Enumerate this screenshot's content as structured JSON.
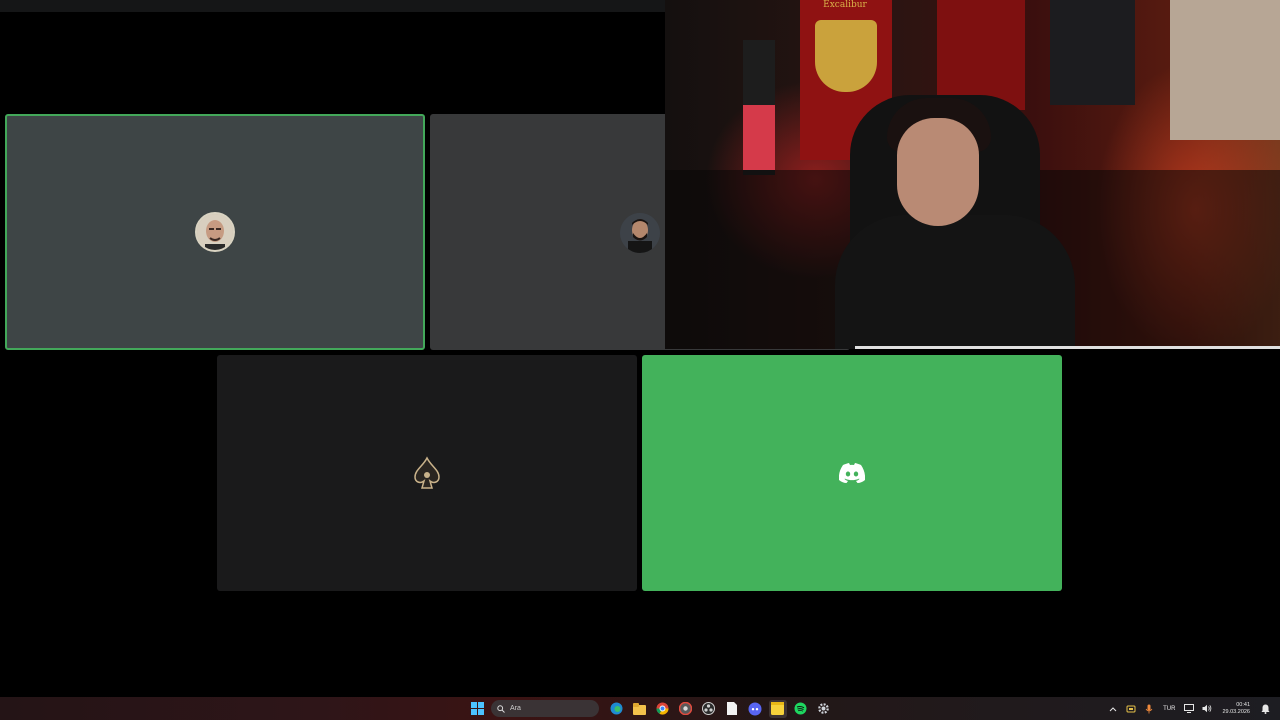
{
  "participants": [
    {
      "id": "p1",
      "speaking": true,
      "avatar": "bald-man-avatar",
      "tile_color": "#3e4546"
    },
    {
      "id": "p2",
      "speaking": false,
      "avatar": "bearded-man-avatar",
      "tile_color": "#38393a"
    },
    {
      "id": "p3",
      "speaking": false,
      "avatar": "spade-emblem-avatar",
      "tile_color": "#1a1a1b"
    },
    {
      "id": "p4",
      "speaking": false,
      "avatar": "discord-logo-avatar",
      "tile_color": "#43b25b"
    }
  ],
  "speaking_outline_color": "#43a85a",
  "webcam": {
    "banner_text": "Excalibur"
  },
  "taskbar": {
    "search_placeholder": "Ara",
    "apps": [
      "windows-start-icon",
      "edge-icon",
      "file-explorer-icon",
      "chrome-icon",
      "chrome-alt-icon",
      "obs-icon",
      "file-icon",
      "discord-icon",
      "sticky-notes-icon",
      "spotify-icon",
      "settings-icon"
    ],
    "active_app": "sticky-notes-icon",
    "tray": {
      "language": "TUR",
      "time": "00:41",
      "date": "29.03.2026"
    }
  }
}
